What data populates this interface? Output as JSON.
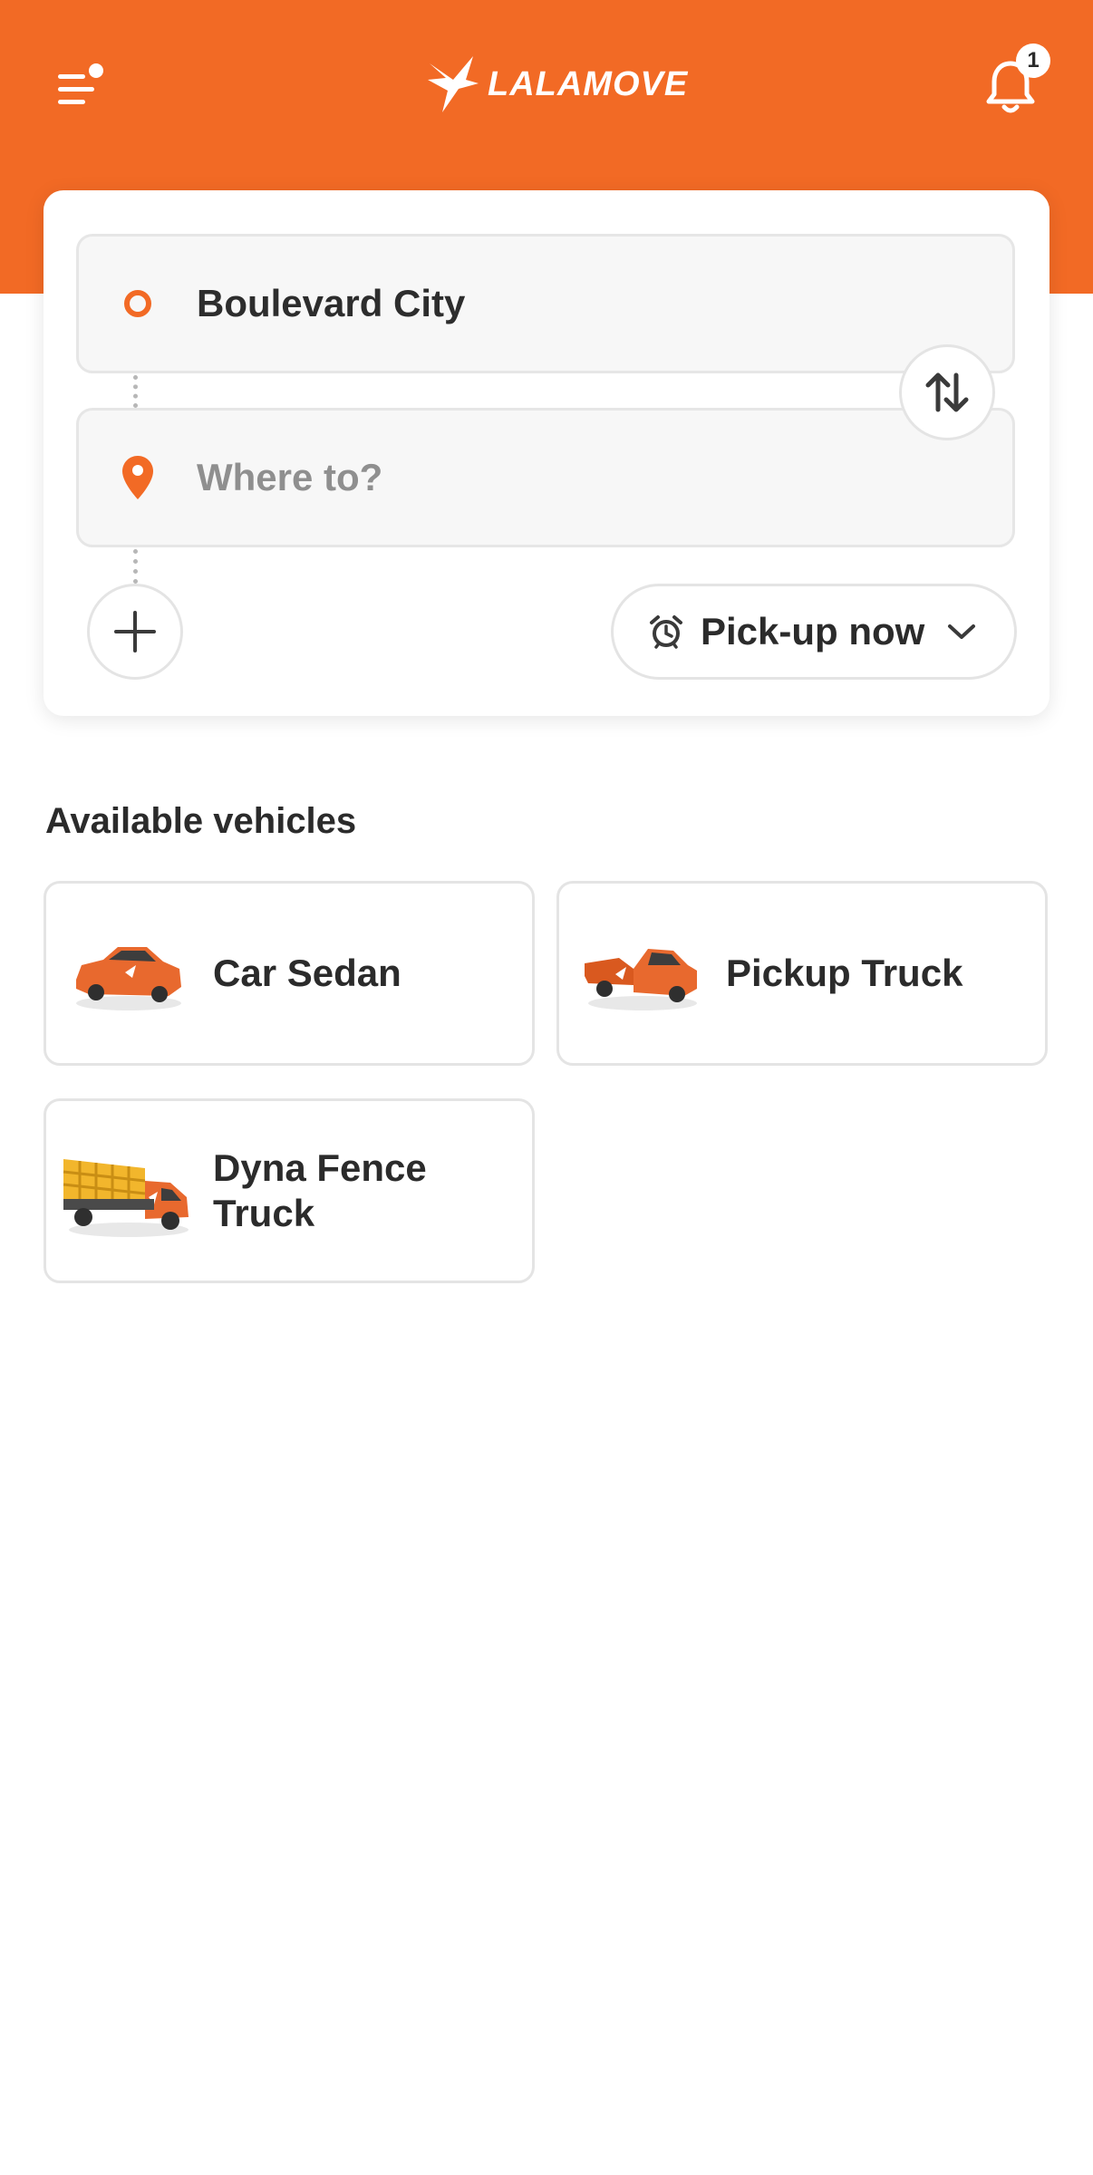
{
  "colors": {
    "brand": "#F26A25",
    "text": "#2B2B2B",
    "placeholder": "#8F8F8F",
    "border": "#E4E4E4"
  },
  "header": {
    "menu_icon": "menu-icon",
    "logo_text": "LALAMOVE",
    "notification_icon": "bell-icon",
    "notification_count": "1"
  },
  "route": {
    "pickup_icon": "origin-circle-icon",
    "pickup_value": "Boulevard City",
    "dropoff_icon": "location-pin-icon",
    "dropoff_placeholder": "Where to?",
    "swap_icon": "swap-arrows-icon",
    "add_stop_icon": "plus-icon",
    "schedule_icon": "alarm-clock-icon",
    "schedule_label": "Pick-up now",
    "schedule_chevron": "chevron-down-icon"
  },
  "vehicles": {
    "title": "Available vehicles",
    "items": [
      {
        "name": "Car Sedan",
        "icon": "sedan-car-icon"
      },
      {
        "name": "Pickup Truck",
        "icon": "pickup-truck-icon"
      },
      {
        "name": "Dyna Fence Truck",
        "icon": "fence-truck-icon"
      }
    ]
  }
}
